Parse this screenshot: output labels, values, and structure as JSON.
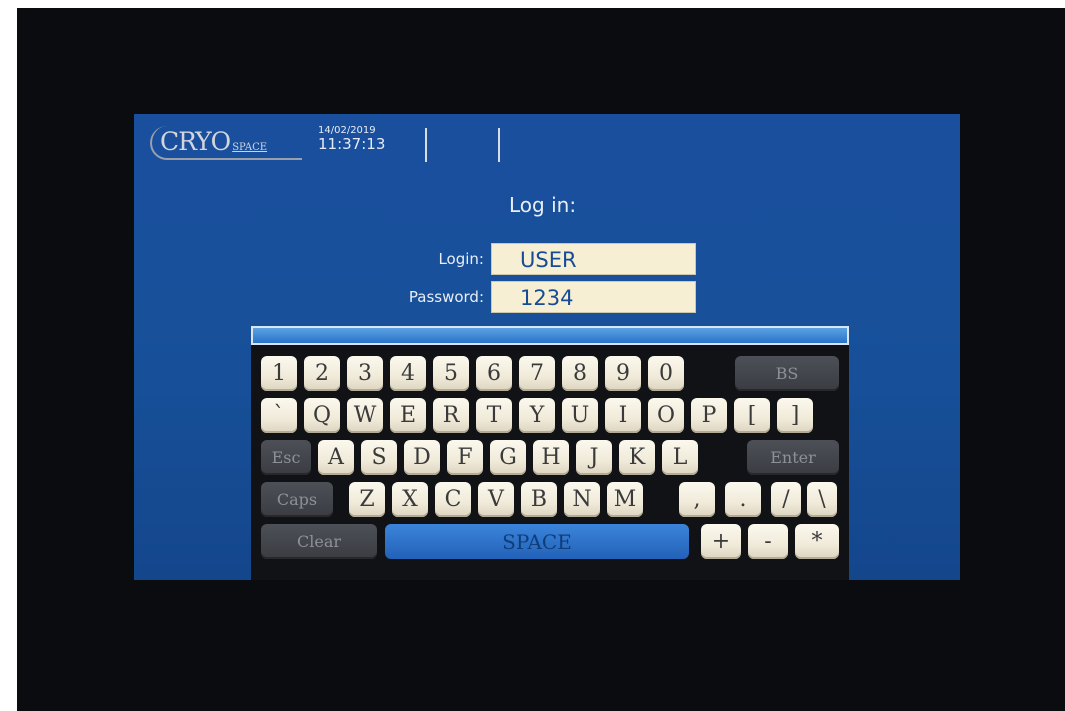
{
  "header": {
    "logo_main": "CRYO",
    "logo_sub": "SPACE",
    "date": "14/02/2019",
    "time": "11:37:13"
  },
  "login": {
    "title": "Log in:",
    "login_label": "Login:",
    "login_value": "USER",
    "password_label": "Password:",
    "password_value": "1234"
  },
  "keyboard": {
    "row1": [
      "1",
      "2",
      "3",
      "4",
      "5",
      "6",
      "7",
      "8",
      "9",
      "0",
      "BS"
    ],
    "row2": [
      "`",
      "Q",
      "W",
      "E",
      "R",
      "T",
      "Y",
      "U",
      "I",
      "O",
      "P",
      "[",
      "]"
    ],
    "row3": [
      "Esc",
      "A",
      "S",
      "D",
      "F",
      "G",
      "H",
      "J",
      "K",
      "L",
      "Enter"
    ],
    "row4": [
      "Caps",
      "Z",
      "X",
      "C",
      "V",
      "B",
      "N",
      "M",
      ",",
      ".",
      "/",
      "\\"
    ],
    "row5": [
      "Clear",
      "SPACE",
      "+",
      "-",
      "*"
    ]
  },
  "colors": {
    "screen_bg": "#1a4f9e",
    "field_bg": "#f6efd3",
    "field_text": "#174b96",
    "key_face": "#f0ead9",
    "key_dark": "#3a3c42",
    "space_key": "#2a6ec4"
  }
}
